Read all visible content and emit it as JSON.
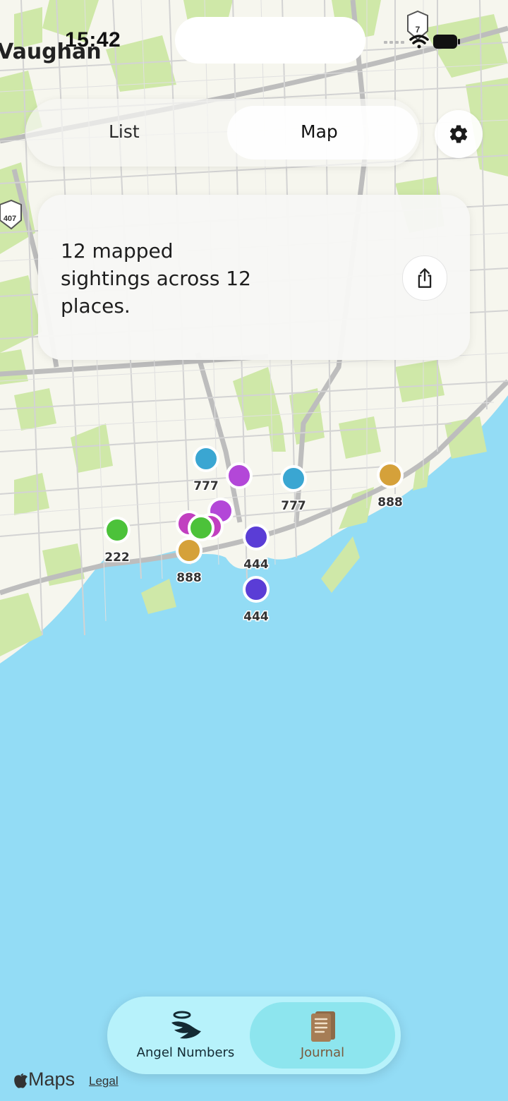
{
  "status_bar": {
    "time": "15:42"
  },
  "map": {
    "place_label": "Vaughan",
    "highway_labels": [
      "407",
      "7"
    ],
    "colors": {
      "water": "#93dcf5",
      "land": "#f6f6ee",
      "park": "#cfe8a8",
      "road": "#c9c9c9"
    },
    "pins": [
      {
        "label": "777",
        "color": "#3aa6d2"
      },
      {
        "label": "",
        "color": "#b347d8"
      },
      {
        "label": "777",
        "color": "#3aa6d2"
      },
      {
        "label": "888",
        "color": "#d5a13a"
      },
      {
        "label": "",
        "color": "#c13fc0"
      },
      {
        "label": "",
        "color": "#b347d8"
      },
      {
        "label": "",
        "color": "#c13fc0"
      },
      {
        "label": "",
        "color": "#4cc23a"
      },
      {
        "label": "222",
        "color": "#4cc23a"
      },
      {
        "label": "888",
        "color": "#d5a13a"
      },
      {
        "label": "444",
        "color": "#5a3dd6"
      },
      {
        "label": "444",
        "color": "#5a3dd6"
      }
    ]
  },
  "segmented_control": {
    "options": [
      "List",
      "Map"
    ],
    "selected": "Map"
  },
  "settings_icon": "gear-icon",
  "summary_card": {
    "text": "12 mapped sightings across 12 places.",
    "share_icon": "share-icon"
  },
  "tab_bar": {
    "tabs": [
      {
        "label": "Angel Numbers",
        "icon": "angel-wing-icon",
        "color": "#132a33"
      },
      {
        "label": "Journal",
        "icon": "journal-book-icon",
        "color": "#7a5a3c"
      }
    ],
    "selected": "Journal"
  },
  "attribution": {
    "brand": "Maps",
    "legal": "Legal"
  }
}
